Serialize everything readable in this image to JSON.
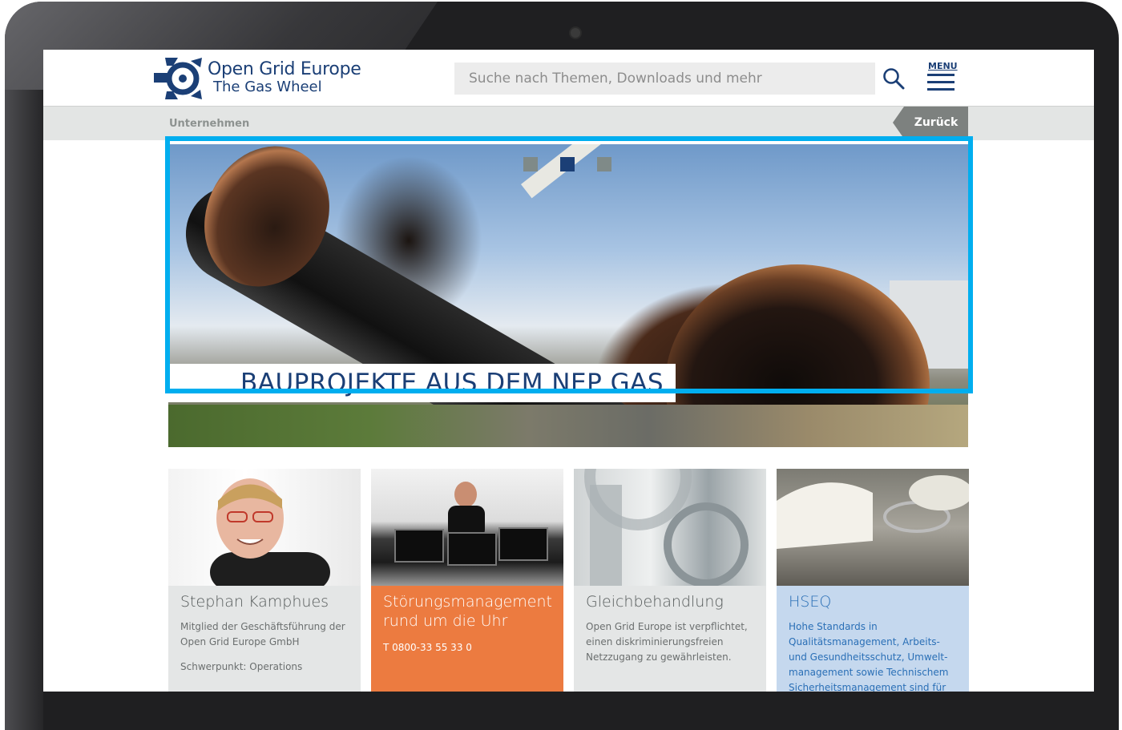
{
  "colors": {
    "brand_blue": "#1b3f76",
    "highlight": "#00aeef",
    "orange": "#ec7b40",
    "light_blue_card": "#c5d8ee",
    "grey_card": "#e4e6e6"
  },
  "header": {
    "logo_line1": "Open Grid Europe",
    "logo_line2": "The Gas Wheel",
    "search_placeholder": "Suche nach Themen, Downloads und mehr",
    "menu_label": "MENU"
  },
  "breadcrumb": {
    "current": "Unternehmen",
    "back_label": "Zurück"
  },
  "hero": {
    "caption": "BAUPROJEKTE AUS DEM NEP GAS",
    "slides_total": 3,
    "active_slide": 2
  },
  "cards": [
    {
      "title": "Stephan Kamphues",
      "text1": "Mitglied der Geschäftsführung der Open Grid Europe GmbH",
      "text2": "Schwerpunkt: Operations"
    },
    {
      "title": "Störungsmanagement rund um die Uhr",
      "text1": "T 0800-33 55 33 0"
    },
    {
      "title": "Gleichbehandlung",
      "text1": "Open Grid Europe ist verpflichtet, einen diskriminierungsfreien Netzzugang zu gewährleisten."
    },
    {
      "title": "HSEQ",
      "text1": "Hohe Standards in Qualitätsmanagement, Arbeits- und Gesundheitsschutz, Umwelt-management sowie Technischem Sicherheitsmanagement sind für [...]"
    }
  ]
}
